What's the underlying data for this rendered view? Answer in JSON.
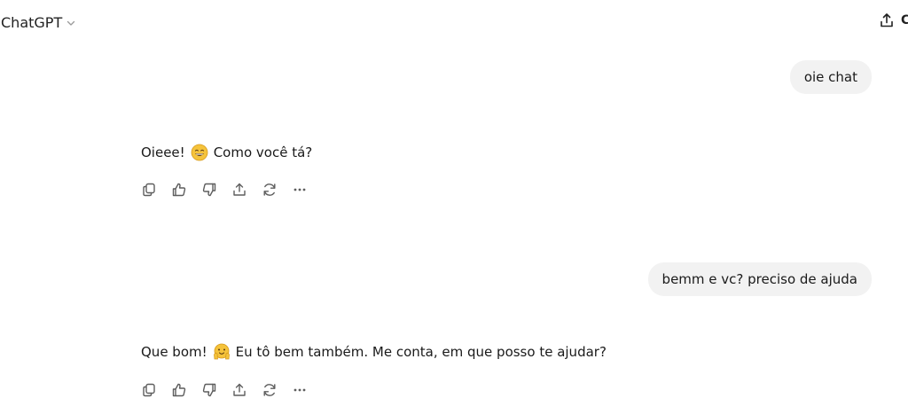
{
  "header": {
    "model_name": "ChatGPT",
    "share_label": "Compartilhar"
  },
  "conversation": [
    {
      "role": "user",
      "text": "oie chat"
    },
    {
      "role": "assistant",
      "before_emoji": "Oieee!",
      "emoji": "grinning-face",
      "after_emoji": "Como você tá?"
    },
    {
      "role": "user",
      "text": "bemm e vc? preciso de ajuda"
    },
    {
      "role": "assistant",
      "before_emoji": "Que bom!",
      "emoji": "hugging-face",
      "after_emoji": "Eu tô bem também. Me conta, em que posso te ajudar?"
    }
  ],
  "message_actions": [
    "copy-icon",
    "thumbs-up-icon",
    "thumbs-down-icon",
    "share-icon",
    "regenerate-icon",
    "more-icon"
  ],
  "colors": {
    "user_bubble_bg": "#f2f2f2",
    "text": "#1a1a1a",
    "icon": "#5d5d5d",
    "emoji_face": "#f5c33b"
  }
}
